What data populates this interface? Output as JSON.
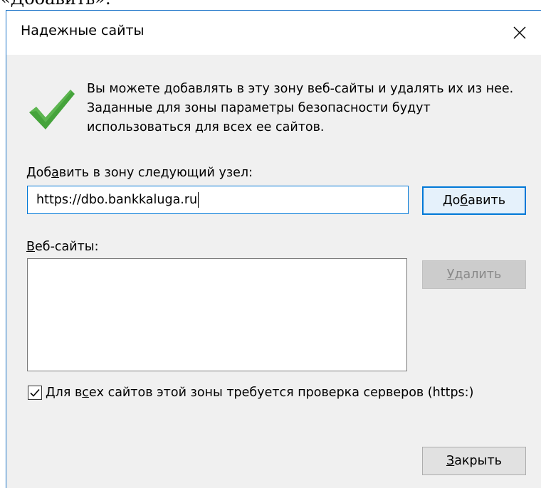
{
  "fragment_text": "«Добавить».",
  "dialog": {
    "title": "Надежные сайты",
    "close_icon": "close-x-icon",
    "status_icon": "green-checkmark-icon",
    "colors": {
      "border": "#1a73c8",
      "accent": "#0078d7",
      "check_green": "#45a33b",
      "background": "#f0f0f0"
    },
    "info_text": "Вы можете добавлять в эту зону  веб-сайты и удалять их из нее. Заданные для зоны параметры безопасности будут использоваться для всех ее сайтов.",
    "add_label": {
      "before": "Доб",
      "underlined": "а",
      "after": "вить в зону следующий узел:"
    },
    "url_input_value": "https://dbo.bankkaluga.ru",
    "add_button": {
      "before": "До",
      "underlined": "б",
      "after": "авить"
    },
    "websites_label": {
      "underlined": "В",
      "after": "еб-сайты:"
    },
    "websites": [],
    "delete_button": {
      "underlined": "У",
      "after": "далить",
      "enabled": false
    },
    "https_checkbox": {
      "checked": true,
      "before": "Для в",
      "underlined": "с",
      "after": "ех сайтов этой зоны требуется проверка серверов (https:)"
    },
    "close_button": {
      "underlined": "З",
      "after": "акрыть"
    }
  }
}
